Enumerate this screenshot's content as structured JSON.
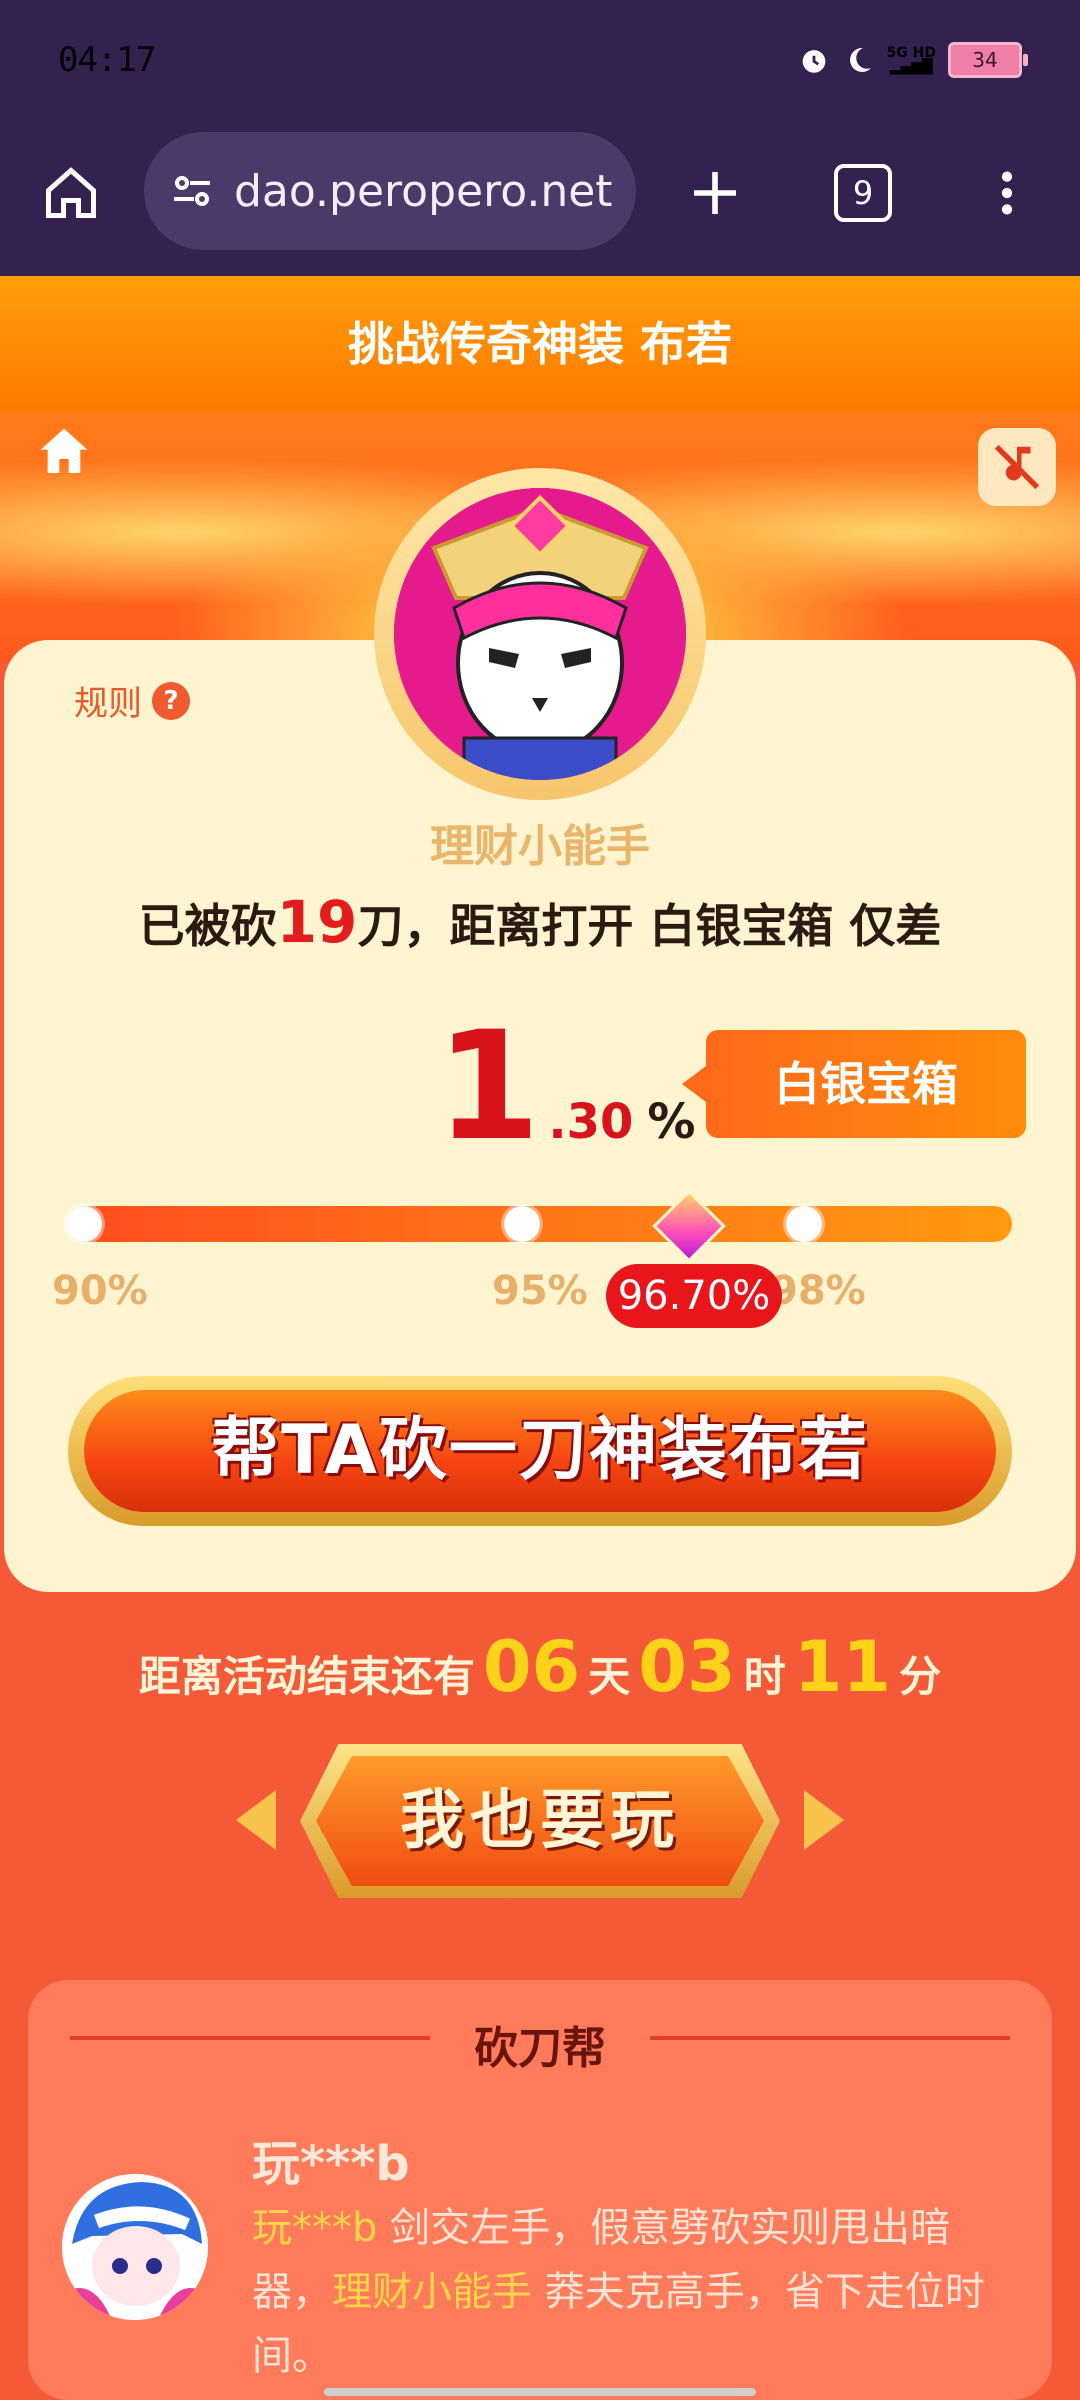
{
  "status_bar": {
    "time": "04:17",
    "network": "5G HD",
    "battery": "34"
  },
  "browser": {
    "url": "dao.peropero.net",
    "tab_count": "9"
  },
  "banner": {
    "title": "挑战传奇神装 布若"
  },
  "card": {
    "rules_label": "规则",
    "rules_icon": "?",
    "nickname": "理财小能手",
    "status_prefix": "已被砍",
    "cut_count": "19",
    "status_suffix": "刀，距离打开 白银宝箱 仅差",
    "remaining_int": "1",
    "remaining_dec": ".30",
    "remaining_unit": "%",
    "chest_name": "白银宝箱",
    "progress": {
      "ticks": [
        "90%",
        "95%",
        "98%"
      ],
      "current": "96.70%",
      "current_value": 96.7
    },
    "help_button": "帮TA砍一刀神装布若"
  },
  "countdown": {
    "prefix": "距离活动结束还有",
    "days": "06",
    "days_unit": "天",
    "hours": "03",
    "hours_unit": "时",
    "minutes": "11",
    "minutes_unit": "分"
  },
  "play_button": "我也要玩",
  "helpers_panel": {
    "title": "砍刀帮",
    "items": [
      {
        "name": "玩***b",
        "msg_name": "玩***b",
        "msg_part1": " 剑交左手，假意劈砍实则甩出暗器，",
        "msg_target": "理财小能手",
        "msg_part2": " 莽夫克高手，省下走位时间。"
      }
    ]
  },
  "colors": {
    "accent": "#ff7a00",
    "danger": "#e31d1d",
    "card_bg": "#fff4d0",
    "page_bg": "#f45a38"
  }
}
